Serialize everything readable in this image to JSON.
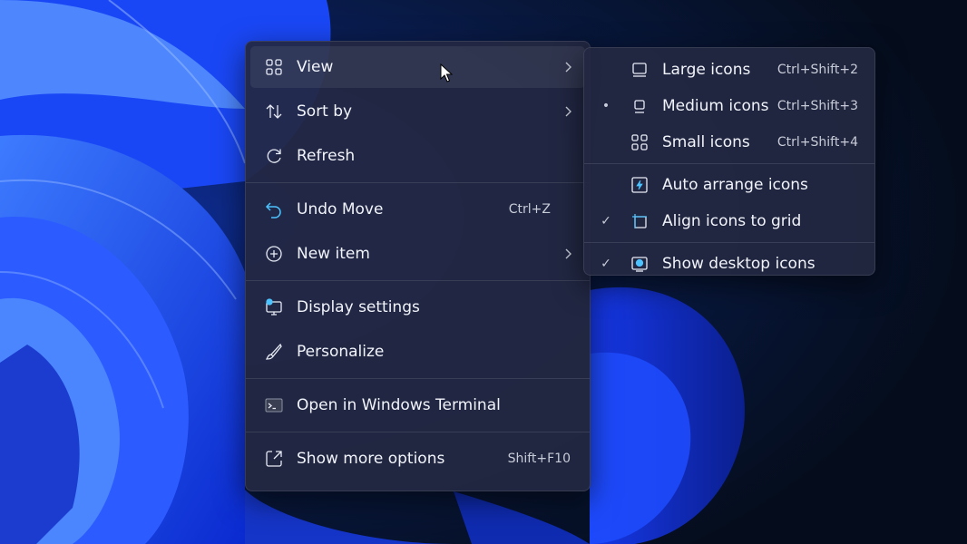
{
  "context_menu": {
    "items": [
      {
        "label": "View",
        "icon": "grid-icon",
        "has_submenu": true
      },
      {
        "label": "Sort by",
        "icon": "sort-arrows-icon",
        "has_submenu": true
      },
      {
        "label": "Refresh",
        "icon": "refresh-icon"
      },
      {
        "label": "Undo Move",
        "icon": "undo-icon",
        "shortcut": "Ctrl+Z"
      },
      {
        "label": "New item",
        "icon": "plus-circle-icon",
        "has_submenu": true
      },
      {
        "label": "Display settings",
        "icon": "monitor-gear-icon"
      },
      {
        "label": "Personalize",
        "icon": "brush-icon"
      },
      {
        "label": "Open in Windows Terminal",
        "icon": "terminal-icon"
      },
      {
        "label": "Show more options",
        "icon": "expand-icon",
        "shortcut": "Shift+F10"
      }
    ]
  },
  "view_submenu": {
    "items": [
      {
        "label": "Large icons",
        "shortcut": "Ctrl+Shift+2",
        "icon": "large-icons-icon",
        "marker": ""
      },
      {
        "label": "Medium icons",
        "shortcut": "Ctrl+Shift+3",
        "icon": "medium-icons-icon",
        "marker": "•"
      },
      {
        "label": "Small icons",
        "shortcut": "Ctrl+Shift+4",
        "icon": "small-icons-icon",
        "marker": ""
      },
      {
        "label": "Auto arrange icons",
        "icon": "auto-arrange-icon",
        "marker": ""
      },
      {
        "label": "Align icons to grid",
        "icon": "align-grid-icon",
        "marker": "✓"
      },
      {
        "label": "Show desktop icons",
        "icon": "show-desktop-icon",
        "marker": "✓"
      }
    ]
  },
  "colors": {
    "accent": "#4cc2ff",
    "menu_bg": "#242842",
    "wallpaper_blue": "#1f4dff"
  }
}
